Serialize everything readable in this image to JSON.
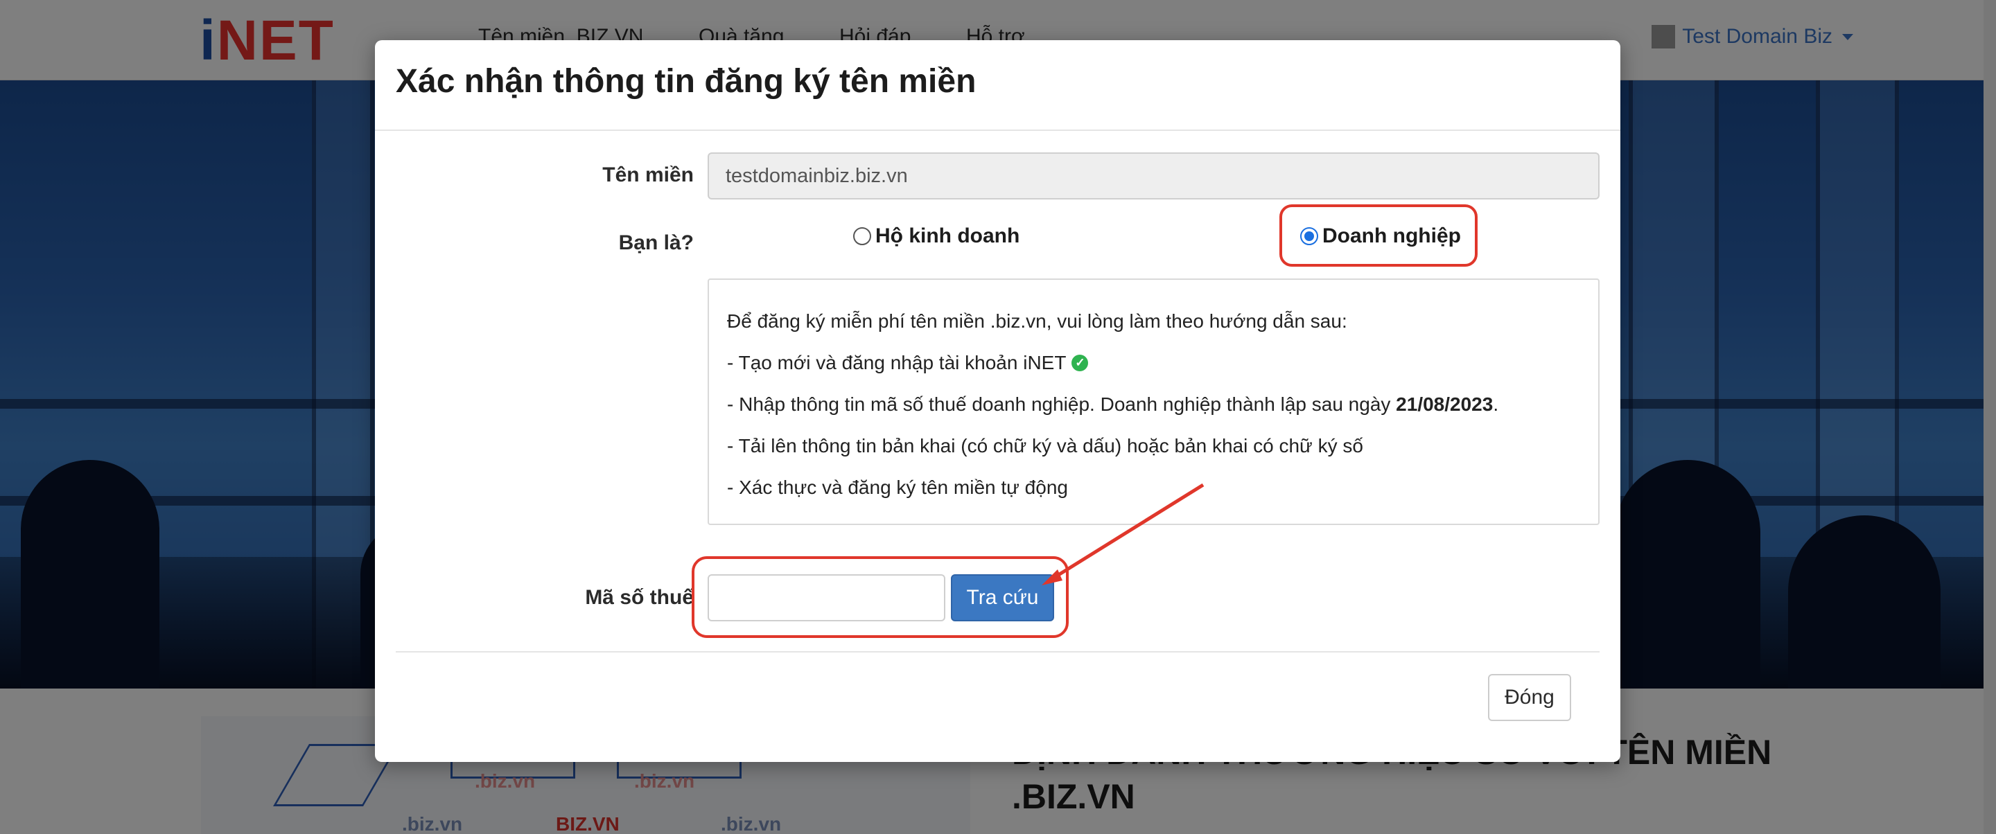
{
  "navbar": {
    "logo_i": "i",
    "logo_net": "NET",
    "links": [
      "Tên miền .BIZ.VN",
      "Quà tặng",
      "Hỏi đáp",
      "Hỗ trợ"
    ],
    "user": "Test Domain Biz"
  },
  "lower": {
    "title": "ĐỊNH DANH THƯƠNG HIỆU SỐ VỚI TÊN MIỀN .BIZ.VN",
    "hex_labels": [
      ".biz.vn",
      ".biz.vn",
      "BIZ.VN",
      ".biz.vn",
      ".biz.vn"
    ]
  },
  "modal": {
    "title": "Xác nhận thông tin đăng ký tên miền",
    "domain_label": "Tên miền",
    "domain_value": "testdomainbiz.biz.vn",
    "type_label": "Bạn là?",
    "option_household": "Hộ kinh doanh",
    "option_business": "Doanh nghiệp",
    "selected_option": "Doanh nghiệp",
    "instructions": {
      "intro": "Để đăng ký miễn phí tên miền .biz.vn, vui lòng làm theo hướng dẫn sau:",
      "step1": "- Tạo mới và đăng nhập tài khoản iNET",
      "step2_prefix": "- Nhập thông tin mã số thuế doanh nghiệp. Doanh nghiệp thành lập sau ngày ",
      "step2_date": "21/08/2023",
      "step2_suffix": ".",
      "step3": "- Tải lên thông tin bản khai (có chữ ký và dấu) hoặc bản khai có chữ ký số",
      "step4": "- Xác thực và đăng ký tên miền tự động"
    },
    "tax_label": "Mã số thuế",
    "tax_value": "",
    "lookup_button": "Tra cứu",
    "close_button": "Đóng"
  },
  "colors": {
    "highlight": "#e0372b",
    "primary_button": "#3b78c2",
    "link": "#3a72c4"
  }
}
